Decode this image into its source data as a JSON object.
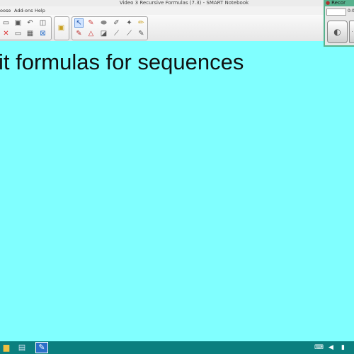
{
  "window": {
    "title": "Video 3 Recursive Formulas (7.3) - SMART Notebook"
  },
  "menu": {
    "items": [
      "oose",
      "Add-ons",
      "Help"
    ]
  },
  "toolbar": {
    "groups": [
      {
        "name": "file-tools",
        "icons": [
          "new-page-icon",
          "open-icon",
          "undo-icon",
          "capture-icon",
          "delete-icon",
          "screen-shade-icon",
          "table-icon",
          "full-screen-icon"
        ]
      },
      {
        "name": "page-tools",
        "icons": [
          "lock-icon"
        ]
      },
      {
        "name": "drawing-tools",
        "icons": [
          "select-icon",
          "pen-icon",
          "eraser-icon",
          "magic-pen-icon",
          "highlighter-icon",
          "creative-pen-icon",
          "shapes-icon",
          "fill-icon",
          "line-icon",
          "properties-icon"
        ]
      }
    ]
  },
  "canvas": {
    "background": "#80ffff",
    "heading": "it formulas for sequences"
  },
  "recorder": {
    "title": "Recor",
    "field_placeholder": "",
    "time": "0:0"
  },
  "taskbar": {
    "color": "#0b7f7f",
    "apps": [
      "file-explorer-icon",
      "network-icon",
      "smart-notebook-icon"
    ],
    "tray": [
      "keyboard-icon",
      "volume-icon",
      "network-tray-icon"
    ]
  }
}
